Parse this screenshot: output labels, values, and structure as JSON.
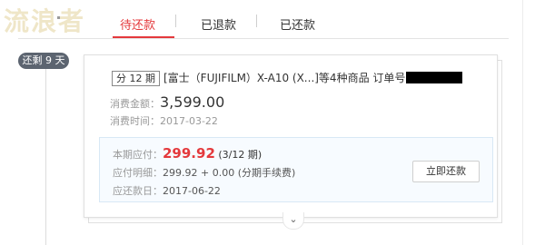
{
  "watermark": "流浪者",
  "tabs": [
    {
      "label": "待还款",
      "active": true
    },
    {
      "label": "已退款",
      "active": false
    },
    {
      "label": "已还款",
      "active": false
    }
  ],
  "timeline": {
    "badge": "还剩 9 天"
  },
  "order": {
    "period_tag": "分 12 期",
    "title": "[富士（FUJIFILM）X-A10 (X...]等4种商品 订单号",
    "amount_label": "消费金额：",
    "amount": "3,599.00",
    "time_label": "消费时间：",
    "time": "2017-03-22"
  },
  "bill": {
    "due_label": "本期应付：",
    "due_amount": "299.92",
    "due_period": "(3/12 期)",
    "detail_label": "应付明细：",
    "detail": "299.92 + 0.00 (分期手续费)",
    "date_label": "应还款日：",
    "date": "2017-06-22",
    "pay_button": "立即还款"
  },
  "expand_icon": "chevron-down",
  "colors": {
    "accent": "#e4393c",
    "badge_bg": "#5c6470",
    "panel_bg": "#f7fbff"
  }
}
